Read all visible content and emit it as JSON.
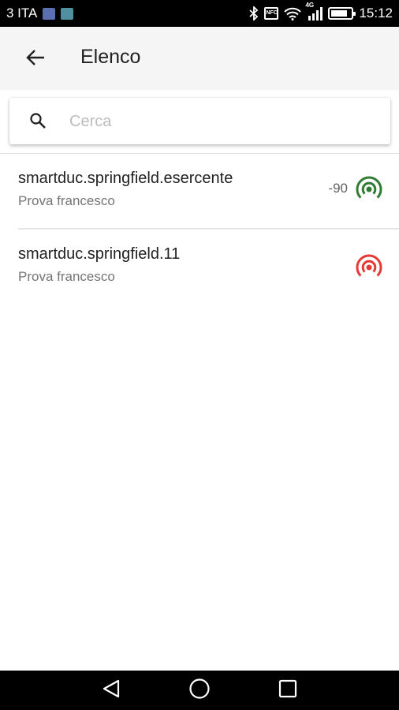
{
  "status_bar": {
    "carrier": "3 ITA",
    "network_type": "4G",
    "nfc_label": "NFC",
    "time": "15:12",
    "battery_level": 0.85
  },
  "app_bar": {
    "title": "Elenco"
  },
  "search": {
    "placeholder": "Cerca",
    "value": ""
  },
  "devices": [
    {
      "name": "smartduc.springfield.esercente",
      "description": "Prova francesco",
      "rssi": "-90",
      "signal_color": "#2e7d32"
    },
    {
      "name": "smartduc.springfield.11",
      "description": "Prova francesco",
      "rssi": "",
      "signal_color": "#e53935"
    }
  ],
  "icons": {
    "back": "arrow-back-icon",
    "search": "search-icon",
    "signal": "broadcast-signal-icon",
    "nav_back": "triangle-back-icon",
    "nav_home": "circle-home-icon",
    "nav_recents": "square-recents-icon"
  }
}
